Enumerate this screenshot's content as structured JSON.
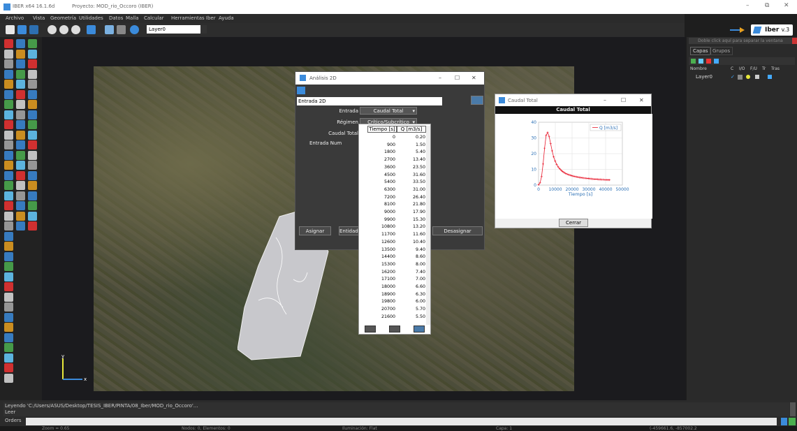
{
  "window": {
    "title": "IBER x64 16.1.6d",
    "project": "Proyecto: MOD_rio_Occoro (IBER)"
  },
  "menu": [
    "Archivo",
    "Vista",
    "Geometría",
    "Utilidades",
    "Datos",
    "Malla",
    "Calcular",
    "Herramientas Iber",
    "Ayuda"
  ],
  "toolbar": {
    "layer_value": "Layer0"
  },
  "logo": {
    "text": "Iber",
    "version": "v.3"
  },
  "layers_panel": {
    "hint": "Doble click aquí para separar la ventana",
    "tabs": [
      "Capas",
      "Grupos"
    ],
    "columns": [
      "Nombre",
      "C",
      "I/O",
      "F/U",
      "Tr",
      "Tras"
    ],
    "rows": [
      {
        "name": "Layer0"
      }
    ]
  },
  "dialog": {
    "title": "Análisis 2D",
    "entrada_select": "Entrada 2D",
    "fields": {
      "entrada_label": "Entrada",
      "entrada_value": "Caudal Total",
      "regimen_label": "Régimen",
      "regimen_value": "Crítico/Subcrítico",
      "caudal_label": "Caudal Total",
      "entrada_num_label": "Entrada Num"
    },
    "buttons": {
      "asignar": "Asignar",
      "entidades": "Entidades",
      "desasignar": "Desasignar"
    }
  },
  "table": {
    "col_time": "Tiempo [s]",
    "col_q": "Q [m3/s]",
    "rows": [
      [
        "0",
        "0.20"
      ],
      [
        "900",
        "1.50"
      ],
      [
        "1800",
        "5.40"
      ],
      [
        "2700",
        "13.40"
      ],
      [
        "3600",
        "23.50"
      ],
      [
        "4500",
        "31.60"
      ],
      [
        "5400",
        "33.50"
      ],
      [
        "6300",
        "31.00"
      ],
      [
        "7200",
        "26.40"
      ],
      [
        "8100",
        "21.80"
      ],
      [
        "9000",
        "17.90"
      ],
      [
        "9900",
        "15.30"
      ],
      [
        "10800",
        "13.20"
      ],
      [
        "11700",
        "11.60"
      ],
      [
        "12600",
        "10.40"
      ],
      [
        "13500",
        "9.40"
      ],
      [
        "14400",
        "8.60"
      ],
      [
        "15300",
        "8.00"
      ],
      [
        "16200",
        "7.40"
      ],
      [
        "17100",
        "7.00"
      ],
      [
        "18000",
        "6.60"
      ],
      [
        "18900",
        "6.30"
      ],
      [
        "19800",
        "6.00"
      ],
      [
        "20700",
        "5.70"
      ],
      [
        "21600",
        "5.50"
      ]
    ]
  },
  "chart_window": {
    "title": "Caudal Total",
    "close_label": "Cerrar"
  },
  "chart_data": {
    "type": "line",
    "title": "Caudal Total",
    "xlabel": "Tiempo [s]",
    "ylabel": "",
    "xlim": [
      0,
      50000
    ],
    "ylim": [
      0,
      40
    ],
    "xticks": [
      "0",
      "10000",
      "20000",
      "30000",
      "40000",
      "50000"
    ],
    "yticks": [
      "0",
      "10",
      "20",
      "30",
      "40"
    ],
    "grid": true,
    "legend": "top-right",
    "series": [
      {
        "name": "Q [m3/s]",
        "color": "#e8192c",
        "x": [
          0,
          900,
          1800,
          2700,
          3600,
          4500,
          5400,
          6300,
          7200,
          8100,
          9000,
          9900,
          10800,
          11700,
          12600,
          13500,
          14400,
          15300,
          16200,
          17100,
          18000,
          18900,
          19800,
          20700,
          21600,
          22500,
          23400,
          24300,
          25200,
          26100,
          27000,
          27900,
          28800,
          29700,
          30600,
          31500,
          32400,
          33300,
          34200,
          35100,
          36000,
          36900,
          37800,
          38700,
          39600,
          40500,
          41400,
          42300
        ],
        "y": [
          0.2,
          1.5,
          5.4,
          13.4,
          23.5,
          31.6,
          33.5,
          31.0,
          26.4,
          21.8,
          17.9,
          15.3,
          13.2,
          11.6,
          10.4,
          9.4,
          8.6,
          8.0,
          7.4,
          7.0,
          6.6,
          6.3,
          6.0,
          5.7,
          5.5,
          5.3,
          5.1,
          4.9,
          4.8,
          4.6,
          4.5,
          4.4,
          4.3,
          4.2,
          4.1,
          4.0,
          3.9,
          3.8,
          3.8,
          3.7,
          3.6,
          3.6,
          3.5,
          3.5,
          3.4,
          3.4,
          3.3,
          3.3
        ]
      }
    ]
  },
  "status": {
    "line1": "Leyendo 'C:/Users/ASUS/Desktop/TESIS_IBER/PINTA/08_Iber/MOD_rio_Occoro'...",
    "line2": "Leer",
    "orders_label": "Orders"
  },
  "bottom": {
    "zoom": "Zoom = 0.65",
    "nodes": "Nodos: 0, Elementos: 0",
    "render": "Iluminación: Flat",
    "layer": "Capa: 1",
    "coords": "(-459661.6, -857002.2"
  }
}
